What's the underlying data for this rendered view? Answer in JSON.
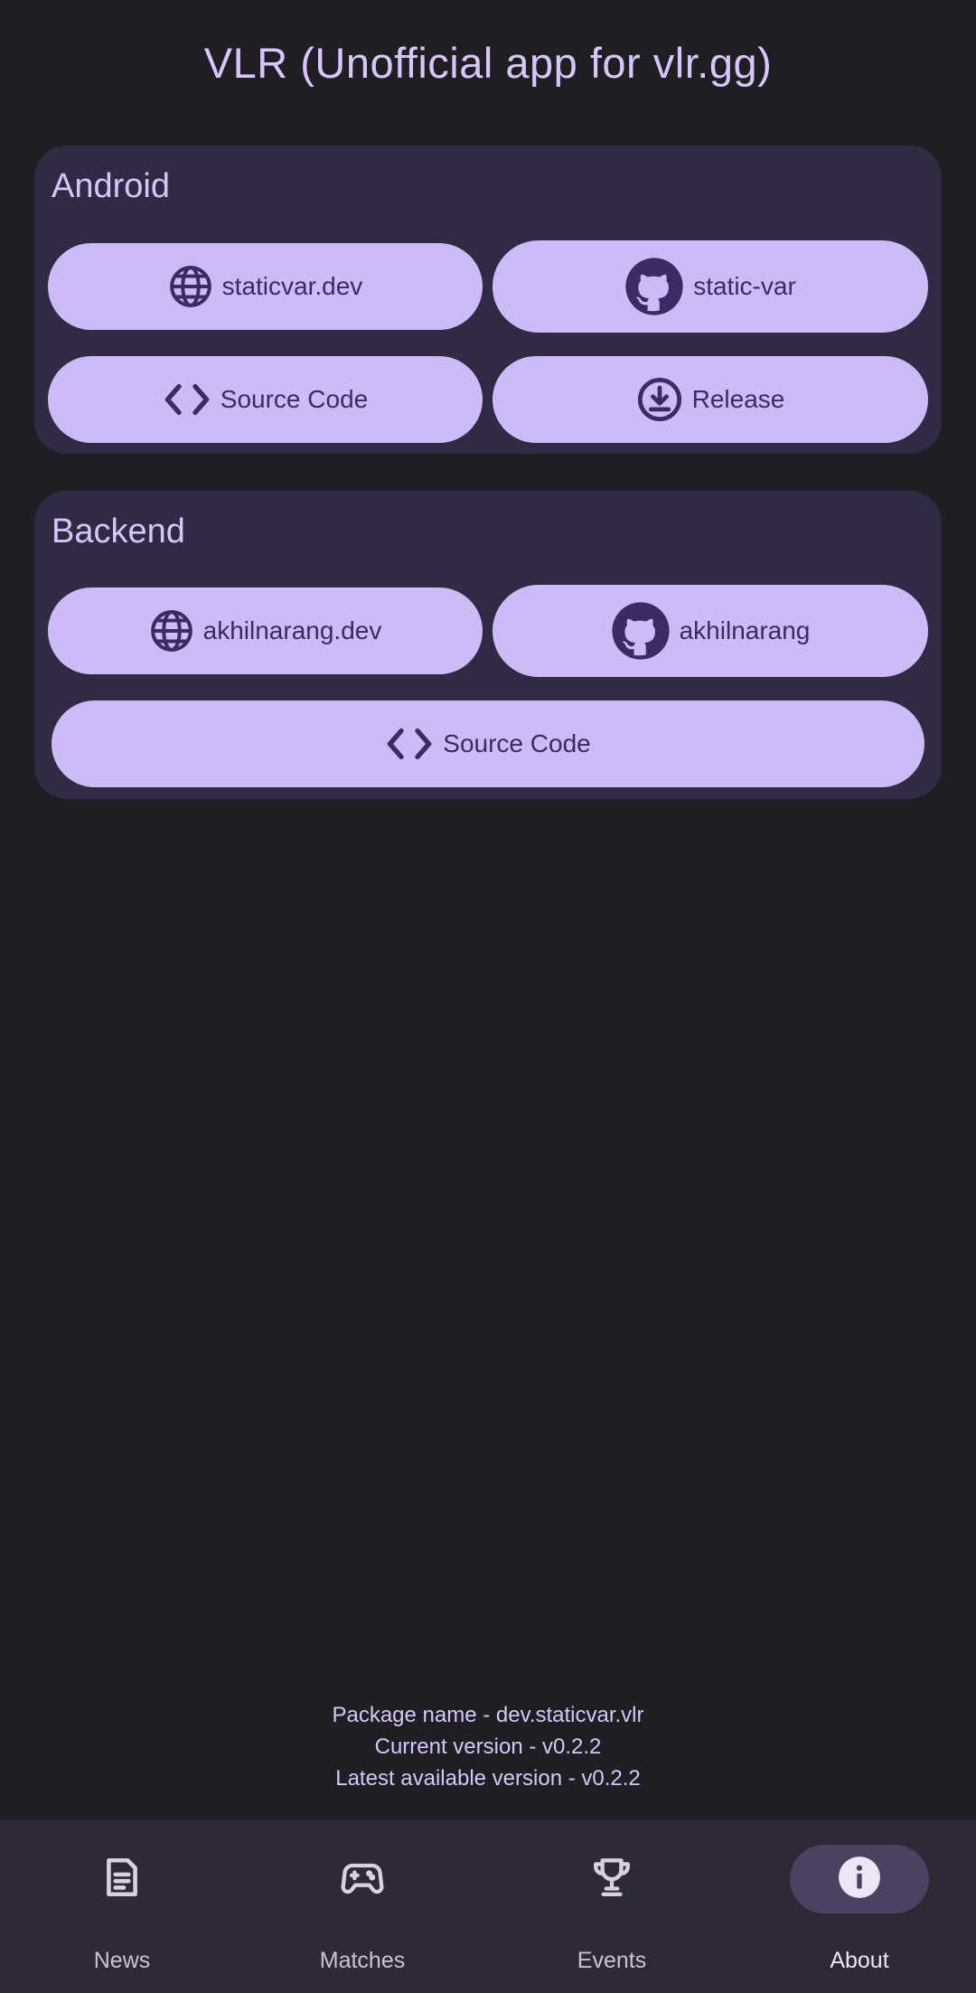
{
  "app_title": "VLR (Unofficial app for vlr.gg)",
  "colors": {
    "background": "#1f1e22",
    "card": "#312a45",
    "button": "#cdbbf7",
    "button_text": "#3b2b62",
    "accent_text": "#d8c6fb",
    "nav_bar": "#2d2a35",
    "nav_active_pill": "#4a4260"
  },
  "android": {
    "title": "Android",
    "website_label": "staticvar.dev",
    "website_icon": "globe-icon",
    "github_label": "static-var",
    "github_icon": "github-icon",
    "source_label": "Source Code",
    "source_icon": "code-icon",
    "release_label": "Release",
    "release_icon": "download-icon"
  },
  "backend": {
    "title": "Backend",
    "website_label": "akhilnarang.dev",
    "website_icon": "globe-icon",
    "github_label": "akhilnarang",
    "github_icon": "github-icon",
    "source_label": "Source Code",
    "source_icon": "code-icon"
  },
  "info": {
    "package": "Package name - dev.staticvar.vlr",
    "current_version": "Current version - v0.2.2",
    "latest_version": "Latest available version - v0.2.2"
  },
  "nav": {
    "items": [
      {
        "label": "News",
        "icon": "article-icon",
        "active": false
      },
      {
        "label": "Matches",
        "icon": "gamepad-icon",
        "active": false
      },
      {
        "label": "Events",
        "icon": "trophy-icon",
        "active": false
      },
      {
        "label": "About",
        "icon": "info-icon",
        "active": true
      }
    ]
  }
}
